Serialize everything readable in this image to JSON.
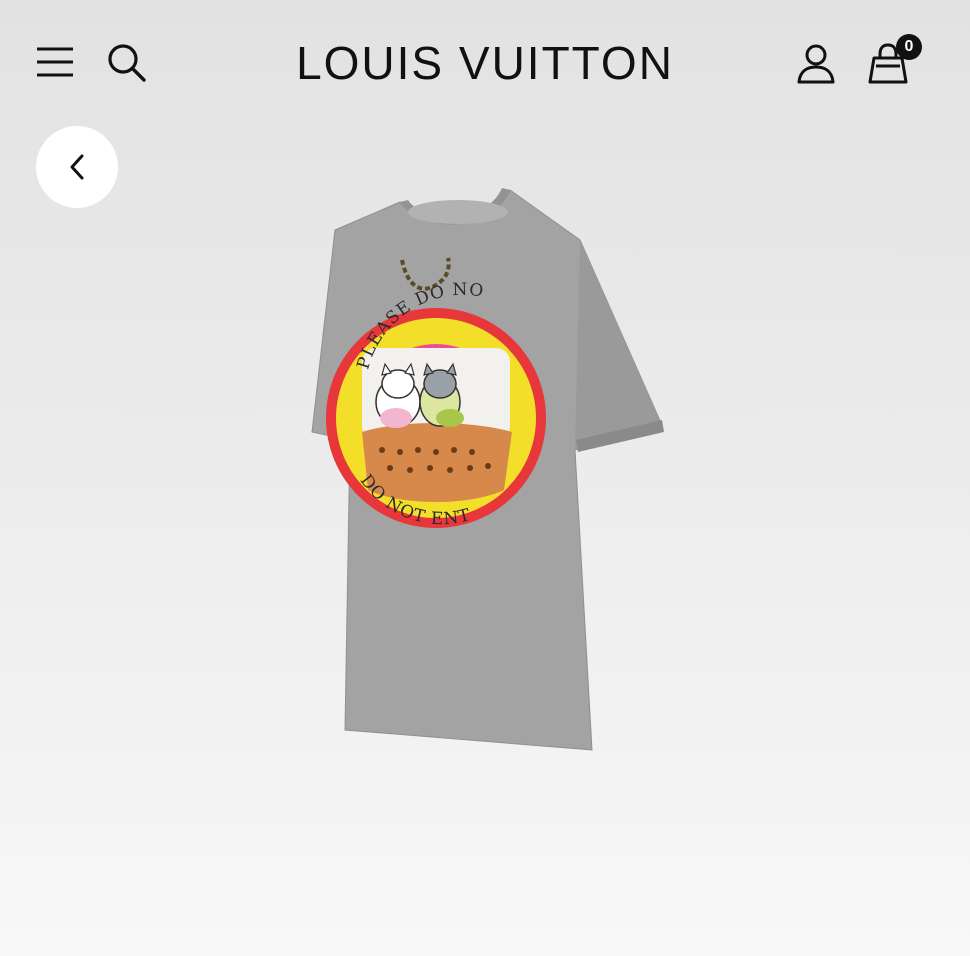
{
  "header": {
    "brand": "LOUIS VUITTON",
    "bag_count": "0"
  },
  "product": {
    "print_text_top": "PLEASE DO NOT ENTER",
    "print_text_bottom": "DO NOT ENTER",
    "colors": {
      "shirt": "#a3a3a3",
      "badge_outer": "#e8373a",
      "badge_ring": "#f3df2a",
      "badge_inner": "#e94e9a"
    }
  }
}
